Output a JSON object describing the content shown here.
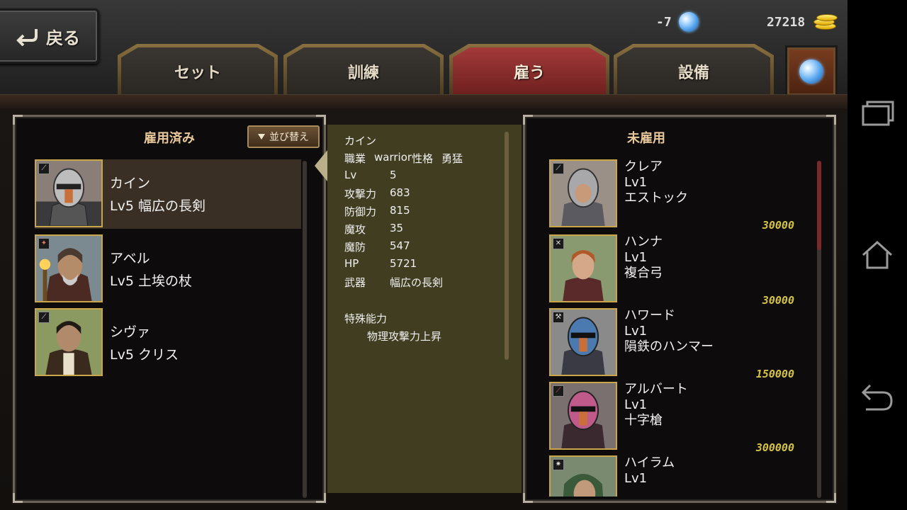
{
  "header": {
    "back_label": "戻る",
    "gems": "-7",
    "gold": "27218"
  },
  "tabs": [
    {
      "label": "セット",
      "active": false
    },
    {
      "label": "訓練",
      "active": false
    },
    {
      "label": "雇う",
      "active": true
    },
    {
      "label": "設備",
      "active": false
    }
  ],
  "hired": {
    "title": "雇用済み",
    "sort_label": "並び替え",
    "items": [
      {
        "name": "カイン",
        "line2": "Lv5 幅広の長剣",
        "portrait": "helmet-knight",
        "badge": "sword-icon"
      },
      {
        "name": "アベル",
        "line2": "Lv5 土埃の杖",
        "portrait": "old-mage",
        "badge": "magic-icon"
      },
      {
        "name": "シヴァ",
        "line2": "Lv5 クリス",
        "portrait": "dark-haired-man",
        "badge": "dagger-icon"
      }
    ]
  },
  "detail": {
    "name": "カイン",
    "job_label": "職業",
    "job_value": "warrior",
    "personality_label": "性格",
    "personality_value": "勇猛",
    "stats": [
      {
        "label": "Lv",
        "value": "5"
      },
      {
        "label": "攻撃力",
        "value": "683"
      },
      {
        "label": "防御力",
        "value": "815"
      },
      {
        "label": "魔攻",
        "value": "35"
      },
      {
        "label": "魔防",
        "value": "547"
      },
      {
        "label": "HP",
        "value": "5721"
      },
      {
        "label": "武器",
        "value": "幅広の長剣"
      }
    ],
    "special_label": "特殊能力",
    "special_value": "物理攻撃力上昇"
  },
  "unhired": {
    "title": "未雇用",
    "items": [
      {
        "name": "クレア",
        "level": "Lv1",
        "weapon": "エストック",
        "price": "30000",
        "portrait": "female-knight",
        "badge": "sword-icon"
      },
      {
        "name": "ハンナ",
        "level": "Lv1",
        "weapon": "複合弓",
        "price": "30000",
        "portrait": "red-haired-archer",
        "badge": "bow-icon"
      },
      {
        "name": "ハワード",
        "level": "Lv1",
        "weapon": "隕鉄のハンマー",
        "price": "150000",
        "portrait": "blue-helmet-knight",
        "badge": "hammer-icon"
      },
      {
        "name": "アルバート",
        "level": "Lv1",
        "weapon": "十字槍",
        "price": "300000",
        "portrait": "pink-helmet-knight",
        "badge": "spear-icon"
      },
      {
        "name": "ハイラム",
        "level": "Lv1",
        "weapon": "",
        "price": "",
        "portrait": "hooded-mage",
        "badge": "star-icon"
      }
    ]
  },
  "colors": {
    "accent_gold": "#c9a64a",
    "active_tab": "#a33a3a",
    "price": "#d4c247",
    "detail_bg": "#413d21"
  }
}
